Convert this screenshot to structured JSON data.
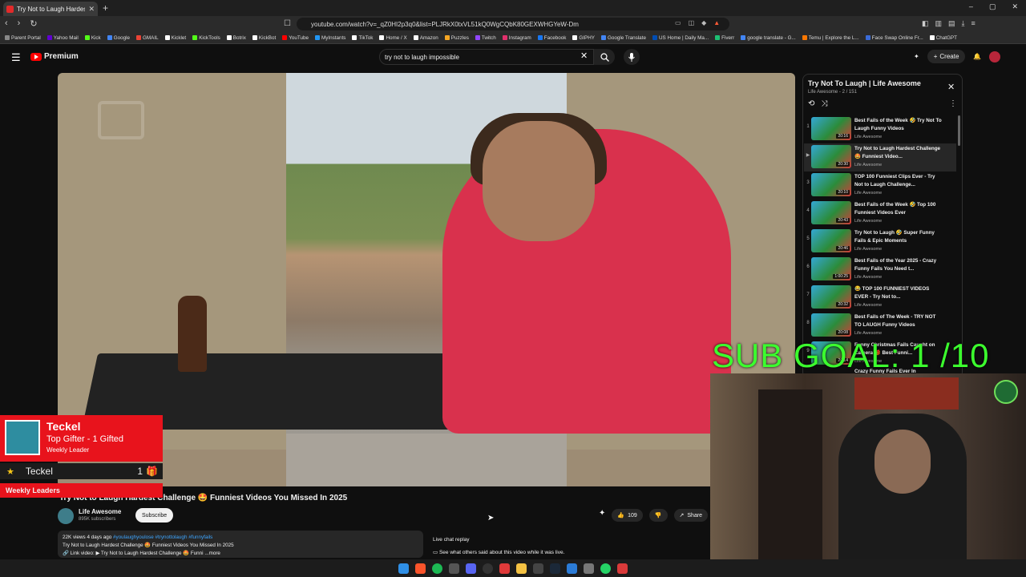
{
  "browser": {
    "tab_title": "Try Not to Laugh Hardest Challe",
    "new_tab": "+",
    "url": "youtube.com/watch?v=_qZ0HI2p3q0&list=PLJRkX0txVL51kQ0WgCQbK80GEXWHGYeW-Dm",
    "window_controls": [
      "–",
      "▢",
      "✕"
    ],
    "bookmarks": [
      {
        "label": "Parent Portal",
        "color": "#888888"
      },
      {
        "label": "Yahoo Mail",
        "color": "#6001d2"
      },
      {
        "label": "Kick",
        "color": "#53fc18"
      },
      {
        "label": "Google",
        "color": "#4285f4"
      },
      {
        "label": "GMAIL",
        "color": "#ea4335"
      },
      {
        "label": "Kicklet",
        "color": "#ffffff"
      },
      {
        "label": "KickTools",
        "color": "#53fc18"
      },
      {
        "label": "Botrix",
        "color": "#ffffff"
      },
      {
        "label": "KickBot",
        "color": "#ffffff"
      },
      {
        "label": "YouTube",
        "color": "#ff0000"
      },
      {
        "label": "MyInstants",
        "color": "#2196f3"
      },
      {
        "label": "TikTok",
        "color": "#ffffff"
      },
      {
        "label": "Home / X",
        "color": "#ffffff"
      },
      {
        "label": "Amazon",
        "color": "#ffffff"
      },
      {
        "label": "Puzzles",
        "color": "#f5a623"
      },
      {
        "label": "Twitch",
        "color": "#9146ff"
      },
      {
        "label": "Instagram",
        "color": "#e1306c"
      },
      {
        "label": "Facebook",
        "color": "#1877f2"
      },
      {
        "label": "GIPHY",
        "color": "#ffffff"
      },
      {
        "label": "Google Translate",
        "color": "#4285f4"
      },
      {
        "label": "US Home | Daily Ma...",
        "color": "#004db3"
      },
      {
        "label": "Fiverr",
        "color": "#1dbf73"
      },
      {
        "label": "google translate - G...",
        "color": "#4285f4"
      },
      {
        "label": "Temu | Explore the L...",
        "color": "#fb7701"
      },
      {
        "label": "Face Swap Online Fr...",
        "color": "#3a6bd8"
      },
      {
        "label": "ChatGPT",
        "color": "#ffffff"
      }
    ]
  },
  "youtube": {
    "logo": "Premium",
    "search_query": "try not to laugh impossible",
    "create": "Create",
    "video_title": "Try Not to Laugh Hardest Challenge 🤩 Funniest Videos You Missed In 2025",
    "channel_name": "Life Awesome",
    "channel_subs": "895K subscribers",
    "subscribe": "Subscribe",
    "likes": "109",
    "share": "Share",
    "description": {
      "stats": "22K views  4 days ago",
      "tags": "#youlaughyoulose #trynottolaugh #funnyfails",
      "line2": "Try Not to Laugh Hardest Challenge 🤩 Funniest Videos You Missed In 2025",
      "line3": "🔗 Link video: ▶ Try Not to Laugh Hardest Challenge 🤩 Funni",
      "more": "...more"
    },
    "live_chat": {
      "title": "Live chat replay",
      "text": "See what others said about this video while it was live."
    }
  },
  "playlist": {
    "title": "Try Not To Laugh | Life Awesome",
    "subtitle": "Life Awesome - 2 / 151",
    "items": [
      {
        "num": "1",
        "title": "Best Fails of the Week 🤣 Try Not To Laugh Funny Videos",
        "channel": "Life Awesome",
        "duration": "20:16"
      },
      {
        "num": "▶",
        "title": "Try Not to Laugh Hardest Challenge 🤩 Funniest Video...",
        "channel": "Life Awesome",
        "duration": "20:30"
      },
      {
        "num": "3",
        "title": "TOP 100 Funniest Clips Ever - Try Not to Laugh Challenge...",
        "channel": "Life Awesome",
        "duration": "20:10"
      },
      {
        "num": "4",
        "title": "Best Fails of the Week 🤣 Top 100 Funniest Videos Ever",
        "channel": "Life Awesome",
        "duration": "20:43"
      },
      {
        "num": "5",
        "title": "Try Not to Laugh 🤣 Super Funny Fails & Epic Moments",
        "channel": "Life Awesome",
        "duration": "20:46"
      },
      {
        "num": "6",
        "title": "Best Fails of the Year 2025 - Crazy Funny Fails You Need t...",
        "channel": "Life Awesome",
        "duration": "1:00:25"
      },
      {
        "num": "7",
        "title": "😂 TOP 100 FUNNIEST VIDEOS EVER - Try Not to...",
        "channel": "Life Awesome",
        "duration": "20:32"
      },
      {
        "num": "8",
        "title": "Best Fails of The Week - TRY NOT TO LAUGH Funny Videos",
        "channel": "Life Awesome",
        "duration": "20:08"
      },
      {
        "num": "9",
        "title": "Funny Christmas Fails Caught on Camera 🎁 Best Funni...",
        "channel": "Life Awesome",
        "duration": "20:14"
      },
      {
        "num": "10",
        "title": "Crazy Funny Fails Ever In",
        "channel": "",
        "duration": ""
      }
    ]
  },
  "overlay": {
    "sub_goal": "SUB GOAL: 1  /10",
    "leader_name": "Teckel",
    "leader_role": "Top Gifter - 1 Gifted",
    "leader_period": "Weekly Leader",
    "row_name": "Teckel",
    "row_count": "1",
    "footer": "Weekly Leaders"
  },
  "colors": {
    "accent_red": "#ff0000",
    "goal_green": "#3cff2e",
    "leader_red": "#e8131c"
  }
}
